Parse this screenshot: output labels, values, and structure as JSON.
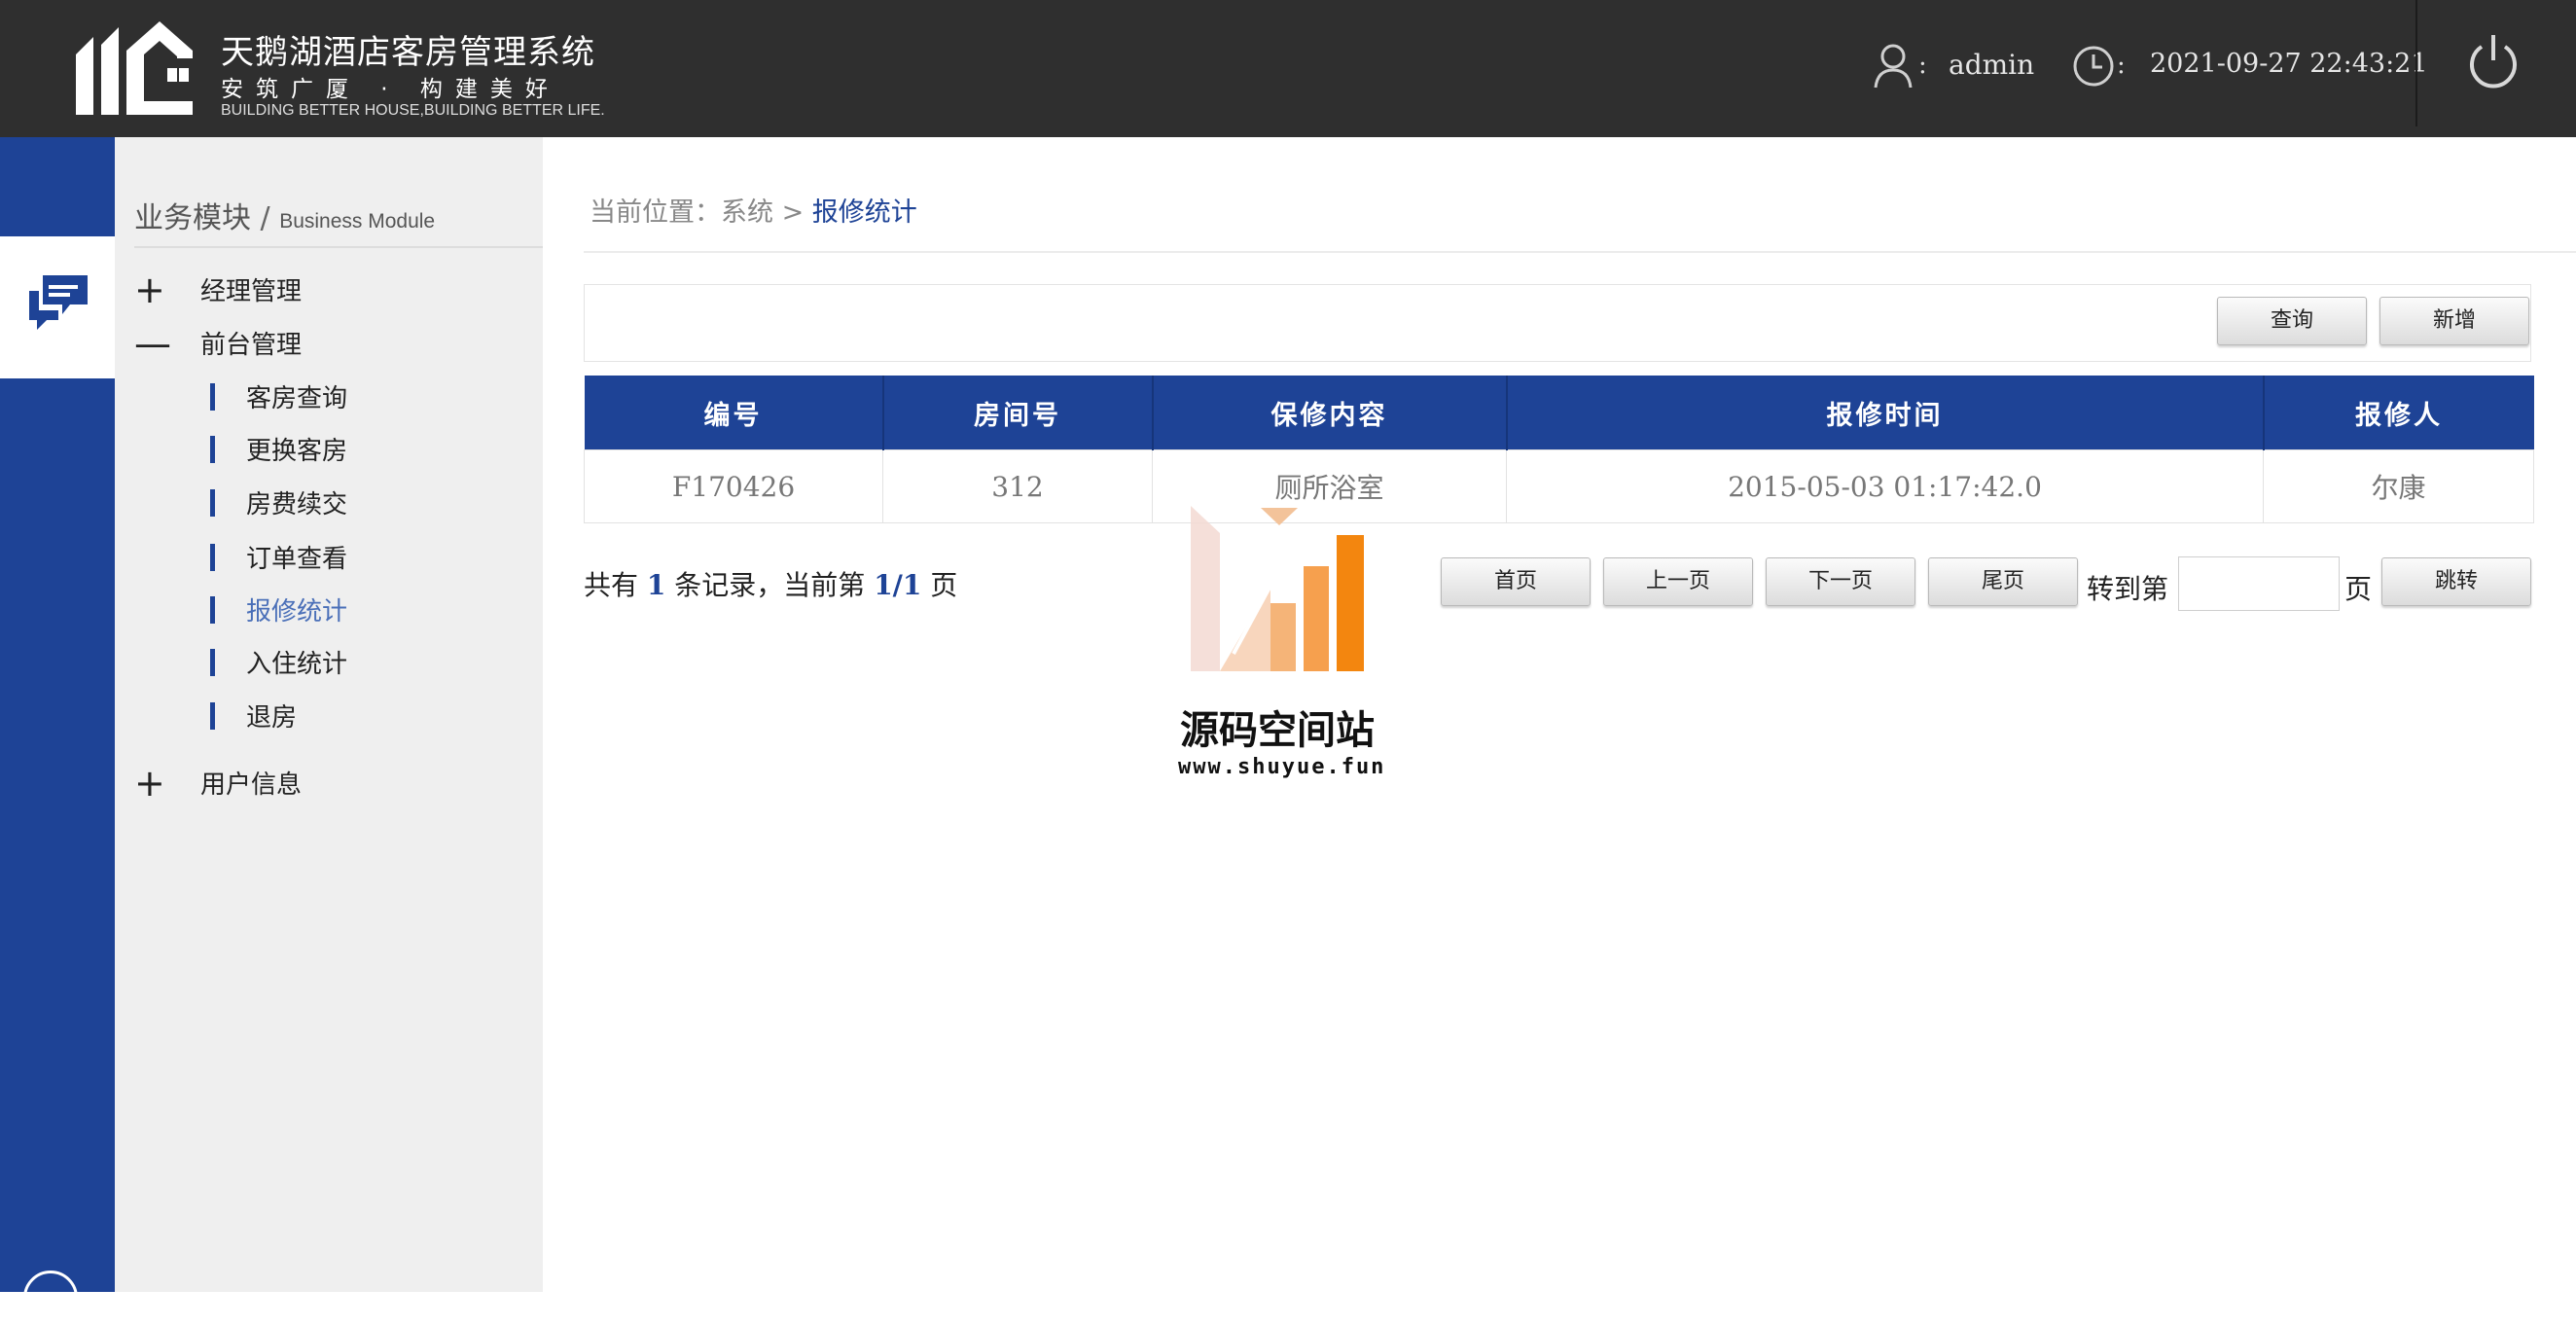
{
  "header": {
    "title": "天鹅湖酒店客房管理系统",
    "slogan": "安筑广厦 · 构建美好",
    "slogan_en": "BUILDING BETTER HOUSE,BUILDING BETTER LIFE.",
    "user_label_colon": ":",
    "user_name": "admin",
    "time_label_colon": ":",
    "datetime": "2021-09-27 22:43:21"
  },
  "sidebar": {
    "module_title_zh": "业务模块",
    "module_title_sep": " / ",
    "module_title_en": "Business Module",
    "groups": [
      {
        "symbol": "+",
        "label": "经理管理"
      },
      {
        "symbol": "—",
        "label": "前台管理"
      },
      {
        "symbol": "+",
        "label": "用户信息"
      }
    ],
    "items": [
      {
        "label": "客房查询"
      },
      {
        "label": "更换客房"
      },
      {
        "label": "房费续交"
      },
      {
        "label": "订单查看"
      },
      {
        "label": "报修统计",
        "active": true
      },
      {
        "label": "入住统计"
      },
      {
        "label": "退房"
      }
    ]
  },
  "breadcrumb": {
    "prefix": "当前位置：系统 > ",
    "current": "报修统计"
  },
  "toolbar": {
    "query_label": "查询",
    "add_label": "新增"
  },
  "table": {
    "columns": [
      "编号",
      "房间号",
      "保修内容",
      "报修时间",
      "报修人"
    ],
    "rows": [
      [
        "F170426",
        "312",
        "厕所浴室",
        "2015-05-03 01:17:42.0",
        "尔康"
      ]
    ]
  },
  "pager": {
    "text1": "共有 ",
    "total": "1",
    "text2": " 条记录，当前第 ",
    "page": "1/1",
    "text3": " 页",
    "first_label": "首页",
    "prev_label": "上一页",
    "next_label": "下一页",
    "last_label": "尾页",
    "goto_prefix": "转到第",
    "goto_suffix": "页",
    "goto_button": "跳转",
    "goto_value": ""
  },
  "watermark": {
    "title": "源码空间站",
    "url": "www.shuyue.fun"
  },
  "colors": {
    "brand_blue": "#1e4396",
    "header_bg": "#2f2f2f",
    "sidebar_bg": "#efefef",
    "active_link": "#4a6fb8"
  }
}
